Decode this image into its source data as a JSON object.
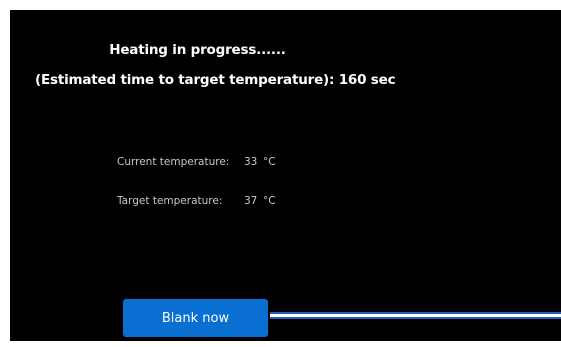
{
  "status": {
    "title": "Heating in progress......",
    "estimate": "(Estimated time to target temperature): 160 sec"
  },
  "readings": {
    "current": {
      "label": "Current temperature:",
      "value": "33",
      "unit": "°C"
    },
    "target": {
      "label": "Target temperature:",
      "value": "37",
      "unit": "°C"
    }
  },
  "actions": {
    "blank_label": "Blank now"
  },
  "colors": {
    "background": "#000000",
    "accent": "#0a6fd2",
    "text": "#ffffff",
    "muted_text": "#c8c8c8"
  }
}
